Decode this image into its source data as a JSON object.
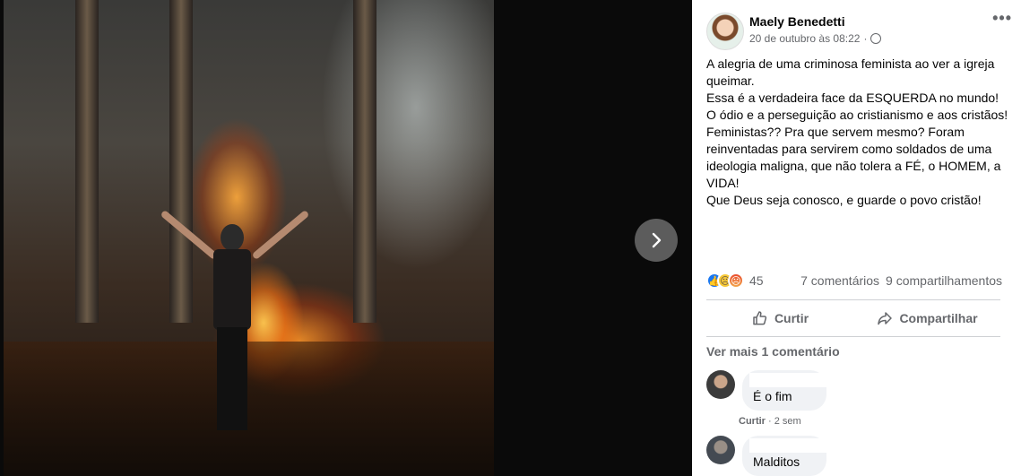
{
  "post": {
    "author": "Maely Benedetti",
    "timestamp": "20 de outubro às 08:22",
    "privacy_icon": "globe-icon",
    "more_label": "•••",
    "text_lines": [
      "A alegria de uma criminosa feminista ao ver a igreja queimar.",
      "Essa é a verdadeira face da ESQUERDA no mundo!",
      "O ódio e a perseguição ao cristianismo e aos cristãos!",
      "Feministas?? Pra que servem mesmo? Foram reinventadas para servirem como soldados de uma ideologia maligna, que não tolera a FÉ, o HOMEM, a VIDA!",
      "Que Deus seja conosco, e guarde o povo cristão!"
    ]
  },
  "reactions": {
    "icons": [
      "like-icon",
      "sad-icon",
      "angry-icon"
    ],
    "count": "45",
    "comments": "7 comentários",
    "shares": "9 compartilhamentos"
  },
  "actions": {
    "like": "Curtir",
    "share": "Compartilhar"
  },
  "view_more": "Ver mais 1 comentário",
  "comments": [
    {
      "name": "",
      "text": "É o fim",
      "like_label": "Curtir",
      "age": "2 sem"
    },
    {
      "name": "",
      "text": "Malditos"
    }
  ],
  "colors": {
    "accent": "#1877f2",
    "secondary_text": "#65676b",
    "bubble": "#f0f2f5"
  }
}
